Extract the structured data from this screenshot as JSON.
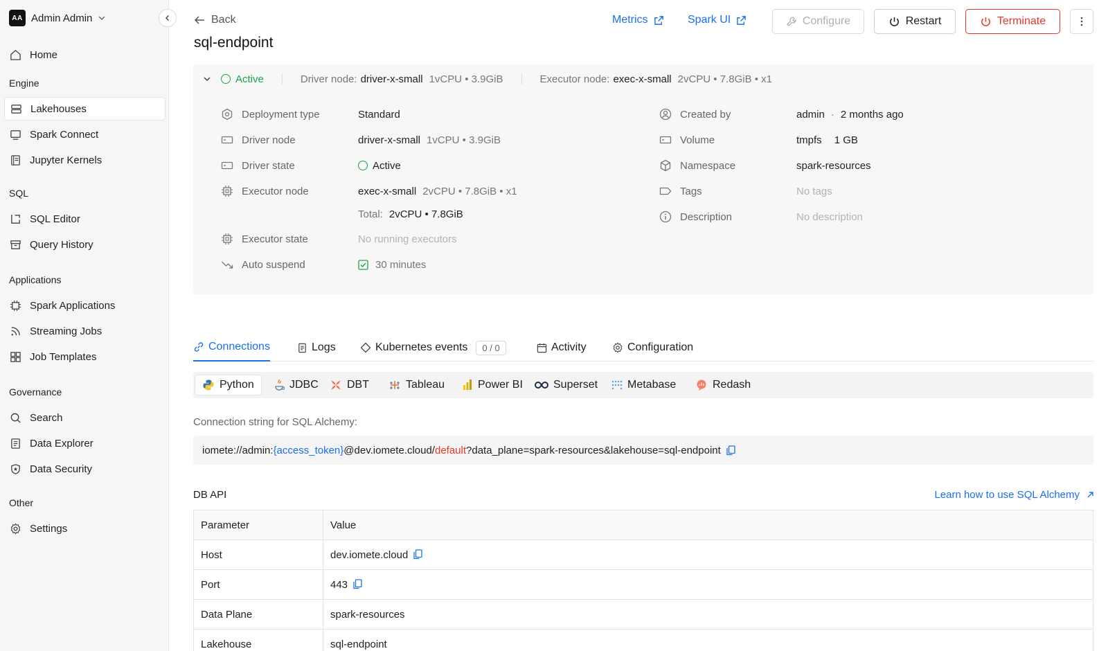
{
  "user": {
    "initials": "AA",
    "name": "Admin Admin"
  },
  "sidebar": {
    "home": "Home",
    "sections": {
      "engine": "Engine",
      "sql": "SQL",
      "applications": "Applications",
      "governance": "Governance",
      "other": "Other"
    },
    "items": {
      "lakehouses": "Lakehouses",
      "spark_connect": "Spark Connect",
      "jupyter_kernels": "Jupyter Kernels",
      "sql_editor": "SQL Editor",
      "query_history": "Query History",
      "spark_applications": "Spark Applications",
      "streaming_jobs": "Streaming Jobs",
      "job_templates": "Job Templates",
      "search": "Search",
      "data_explorer": "Data Explorer",
      "data_security": "Data Security",
      "settings": "Settings"
    },
    "active_item": "Lakehouses"
  },
  "header": {
    "back": "Back",
    "title": "sql-endpoint",
    "metrics": "Metrics",
    "spark_ui": "Spark UI",
    "configure": "Configure",
    "restart": "Restart",
    "terminate": "Terminate"
  },
  "summary": {
    "status": "Active",
    "driver_label": "Driver node:",
    "driver_name": "driver-x-small",
    "driver_spec": "1vCPU • 3.9GiB",
    "executor_label": "Executor node:",
    "executor_name": "exec-x-small",
    "executor_spec": "2vCPU • 7.8GiB • x1"
  },
  "details": {
    "deployment_type": {
      "label": "Deployment type",
      "value": "Standard"
    },
    "driver_node": {
      "label": "Driver node",
      "value": "driver-x-small",
      "spec": "1vCPU • 3.9GiB"
    },
    "driver_state": {
      "label": "Driver state",
      "value": "Active"
    },
    "executor_node": {
      "label": "Executor node",
      "value": "exec-x-small",
      "spec": "2vCPU • 7.8GiB • x1",
      "total_label": "Total:",
      "total_value": "2vCPU • 7.8GiB"
    },
    "executor_state": {
      "label": "Executor state",
      "value": "No running executors"
    },
    "auto_suspend": {
      "label": "Auto suspend",
      "value": "30 minutes"
    },
    "created_by": {
      "label": "Created by",
      "value": "admin",
      "sub": "2 months ago"
    },
    "volume": {
      "label": "Volume",
      "value": "tmpfs",
      "sub": "1 GB"
    },
    "namespace": {
      "label": "Namespace",
      "value": "spark-resources"
    },
    "tags": {
      "label": "Tags",
      "value": "No tags"
    },
    "description": {
      "label": "Description",
      "value": "No description"
    }
  },
  "tabs": {
    "connections": "Connections",
    "logs": "Logs",
    "kubernetes_events": "Kubernetes events",
    "kubernetes_badge": "0 / 0",
    "activity": "Activity",
    "configuration": "Configuration",
    "active": "Connections"
  },
  "languages": {
    "python": "Python",
    "jdbc": "JDBC",
    "dbt": "DBT",
    "tableau": "Tableau",
    "powerbi": "Power BI",
    "superset": "Superset",
    "metabase": "Metabase",
    "redash": "Redash",
    "active": "Python"
  },
  "connection": {
    "label": "Connection string for SQL Alchemy:",
    "part1": "iomete://admin:",
    "token": "{access_token}",
    "part2": "@dev.iomete.cloud/",
    "db": "default",
    "part3": "?data_plane=spark-resources&lakehouse=sql-endpoint"
  },
  "dbapi": {
    "title": "DB API",
    "learn_link": "Learn how to use SQL Alchemy",
    "headers": {
      "parameter": "Parameter",
      "value": "Value"
    },
    "rows": [
      {
        "parameter": "Host",
        "value": "dev.iomete.cloud"
      },
      {
        "parameter": "Port",
        "value": "443"
      },
      {
        "parameter": "Data Plane",
        "value": "spark-resources"
      },
      {
        "parameter": "Lakehouse",
        "value": "sql-endpoint"
      }
    ]
  },
  "colors": {
    "accent": "#1a6ff0",
    "success": "#1aa34a",
    "danger": "#e5372a"
  }
}
